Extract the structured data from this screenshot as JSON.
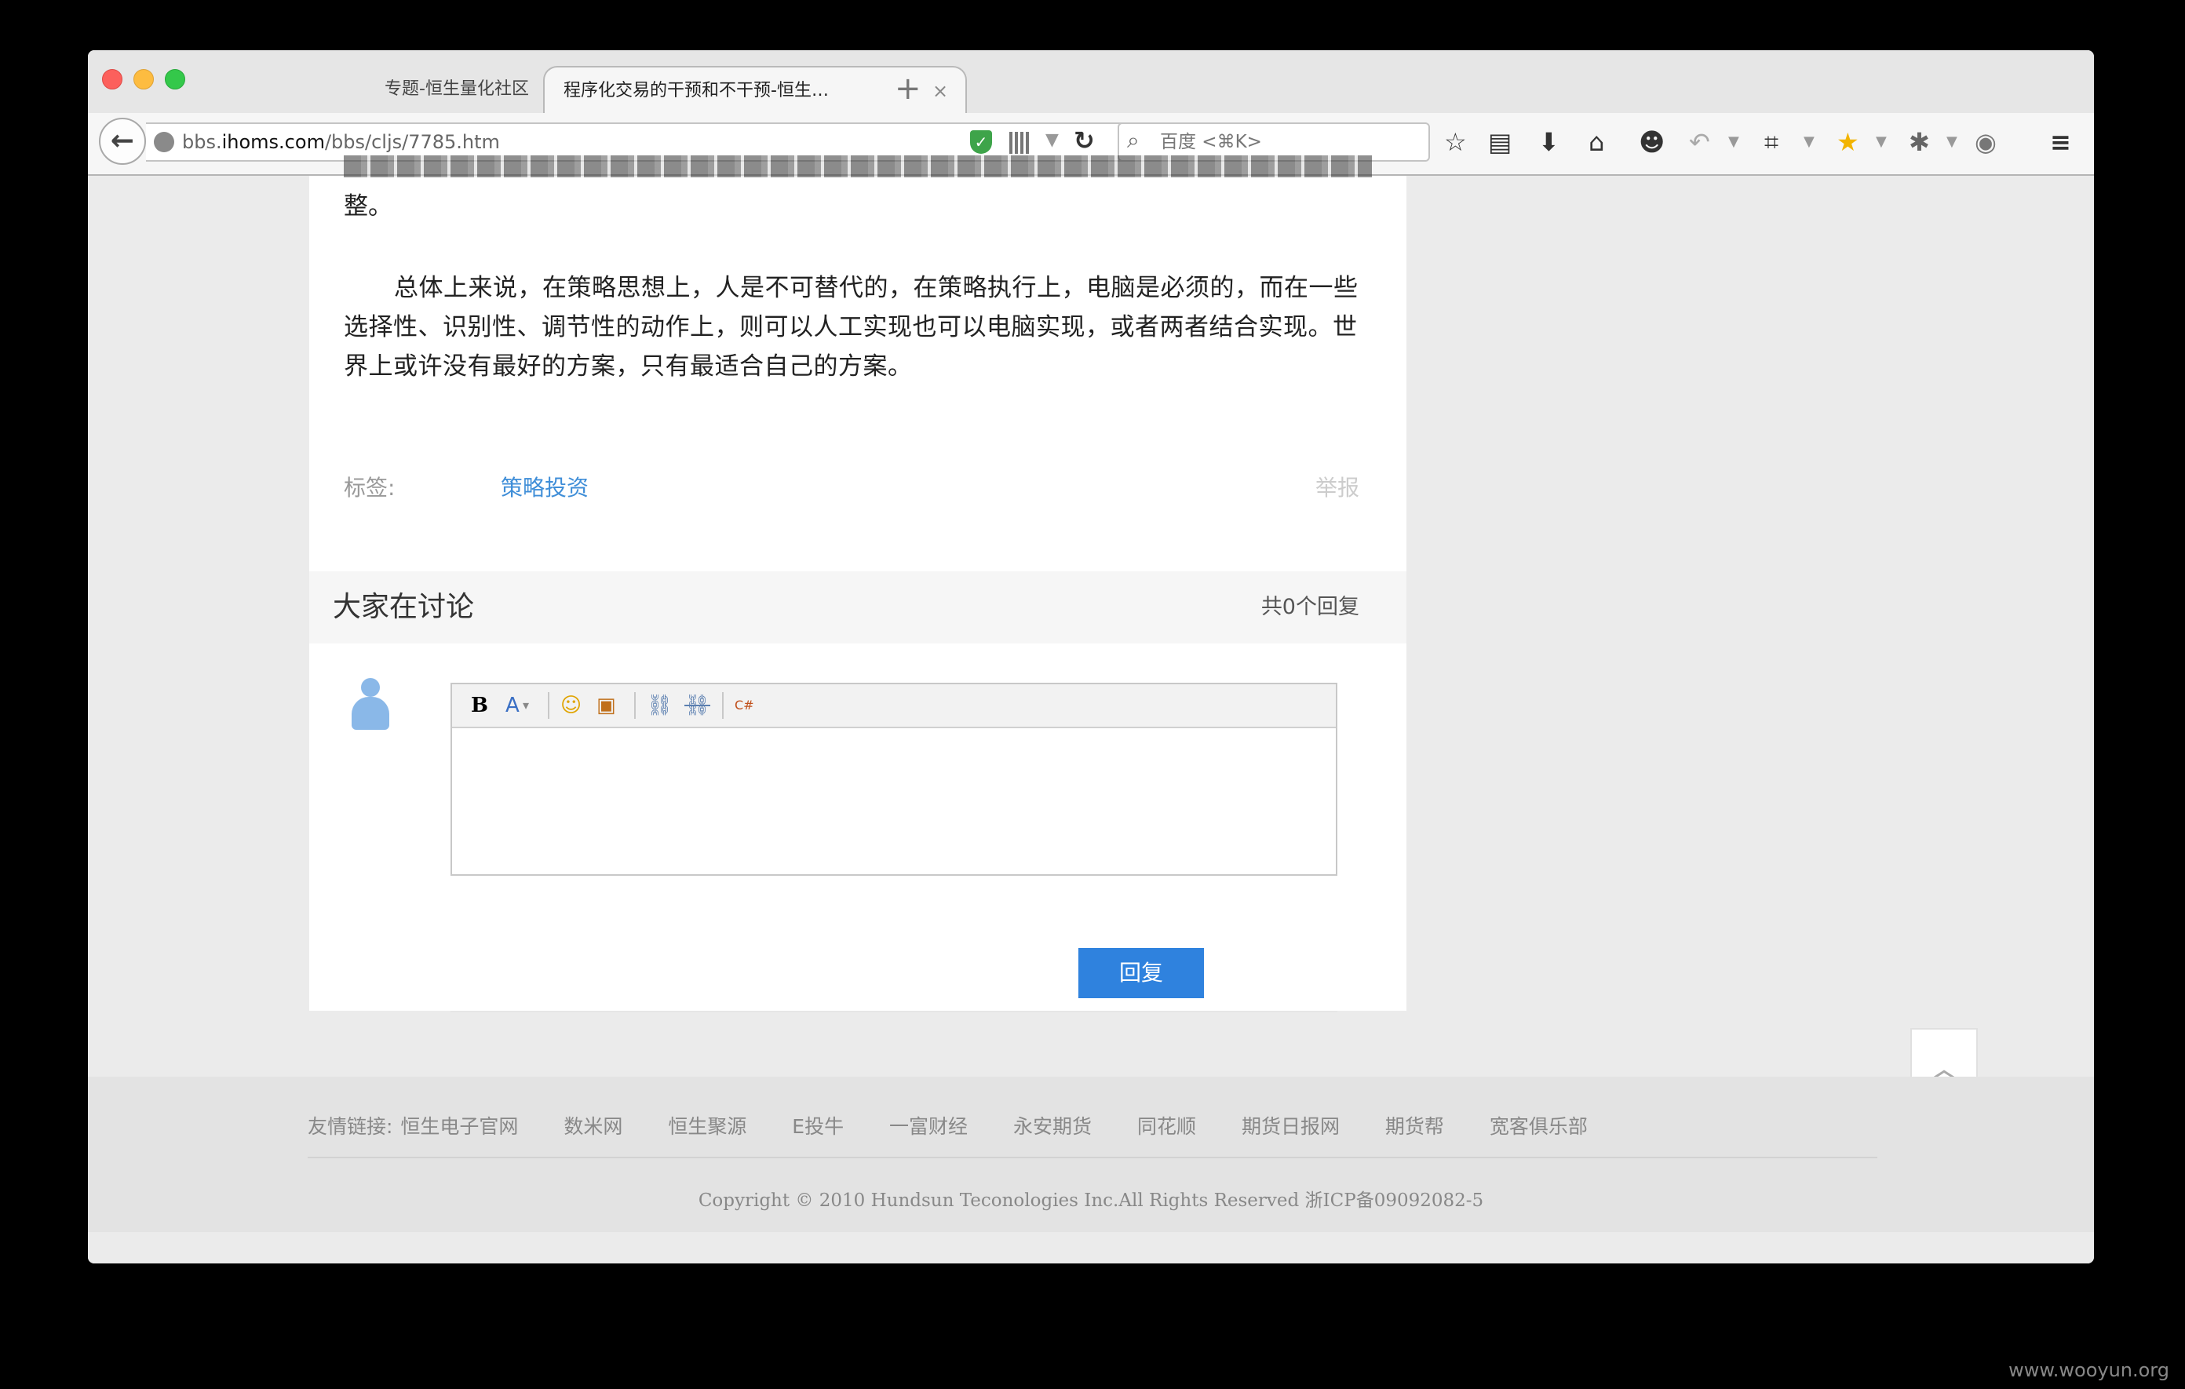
{
  "browser": {
    "tabs": [
      {
        "label": "专题-恒生量化社区",
        "active": false
      },
      {
        "label": "程序化交易的干预和不干预-恒生…",
        "active": true
      }
    ],
    "url_prefix": "bbs.",
    "url_domain": "ihoms.com",
    "url_path": "/bbs/cljs/7785.htm",
    "search_placeholder": "百度 <⌘K>",
    "icons": {
      "back": "←",
      "reload": "↻",
      "bookmark": "☆",
      "reading": "▤",
      "download": "⬇",
      "home": "⌂",
      "chat": "☻",
      "undo": "↶",
      "crop": "⌗",
      "star_ext": "★",
      "bug": "✱",
      "profile": "◉",
      "menu": "≡"
    }
  },
  "article": {
    "fragment_end": "整。",
    "paragraph": "总体上来说，在策略思想上，人是不可替代的，在策略执行上，电脑是必须的，而在一些选择性、识别性、调节性的动作上，则可以人工实现也可以电脑实现，或者两者结合实现。世界上或许没有最好的方案，只有最适合自己的方案。",
    "tags_label": "标签:",
    "tag": "策略投资",
    "report": "举报"
  },
  "discussion": {
    "title": "大家在讨论",
    "count": "共0个回复",
    "toolbar": {
      "bold": "B",
      "font": "A",
      "font_dropdown": "▾",
      "emoji": "☺",
      "image": "▣",
      "link": "⛓",
      "unlink": "⛓",
      "code": "C#"
    },
    "reply_button": "回复"
  },
  "footer": {
    "links_label": "友情链接:",
    "links": [
      "恒生电子官网",
      "数米网",
      "恒生聚源",
      "E投牛",
      "一富财经",
      "永安期货",
      "同花顺",
      "期货日报网",
      "期货帮",
      "宽客俱乐部"
    ],
    "copyright": "Copyright © 2010 Hundsun Teconologies Inc.All Rights Reserved 浙ICP备09092082-5"
  },
  "floating": {
    "top_icon": "︿",
    "edit_icon": "✎"
  },
  "watermark": "www.wooyun.org"
}
